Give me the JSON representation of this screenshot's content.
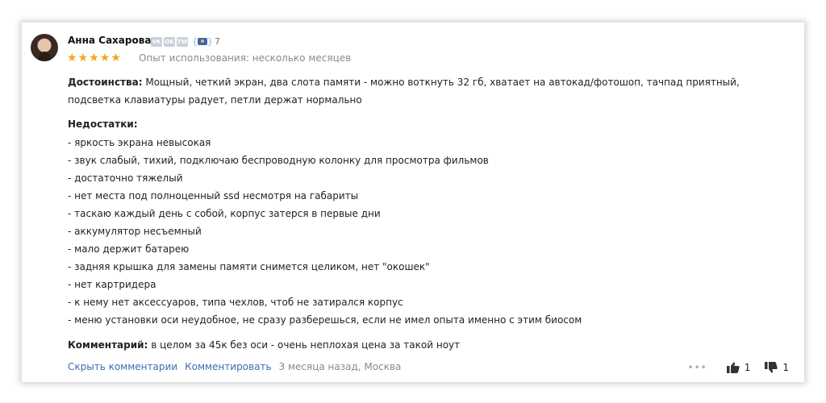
{
  "review": {
    "author": "Анна Сахарова",
    "socials": [
      "VK",
      "OK",
      "TW"
    ],
    "badge_count": "7",
    "rating_stars": 5,
    "experience": "Опыт использования: несколько месяцев",
    "pros_label": "Достоинства:",
    "pros_text": "Мощный, четкий экран, два слота памяти - можно воткнуть 32 гб, хватает на автокад/фотошоп, тачпад приятный, подсветка клавиатуры радует, петли держат нормально",
    "cons_label": "Недостатки:",
    "cons": [
      "- яркость экрана невысокая",
      "- звук слабый, тихий, подключаю беспроводную колонку для просмотра фильмов",
      "- достаточно тяжелый",
      "- нет места под полноценный ssd несмотря на габариты",
      "- таскаю каждый день с собой, корпус затерся в первые дни",
      "- аккумулятор несъемный",
      "- мало держит батарею",
      "- задняя крышка для замены памяти снимется целиком, нет \"окошек\"",
      "- нет картридера",
      "- к нему нет аксессуаров, типа чехлов, чтоб не затирался корпус",
      "- меню установки оси неудобное, не сразу разберешься, если не имел опыта именно с этим биосом"
    ],
    "comment_label": "Комментарий:",
    "comment_text": "в целом за 45к без оси - очень неплохая цена за такой ноут",
    "footer": {
      "hide_comments": "Скрыть комментарии",
      "add_comment": "Комментировать",
      "meta": "3 месяца назад, Москва"
    },
    "likes": "1",
    "dislikes": "1"
  },
  "colors": {
    "star": "#f3a51b",
    "link": "#3b6db5",
    "muted": "#8a8a8a"
  }
}
